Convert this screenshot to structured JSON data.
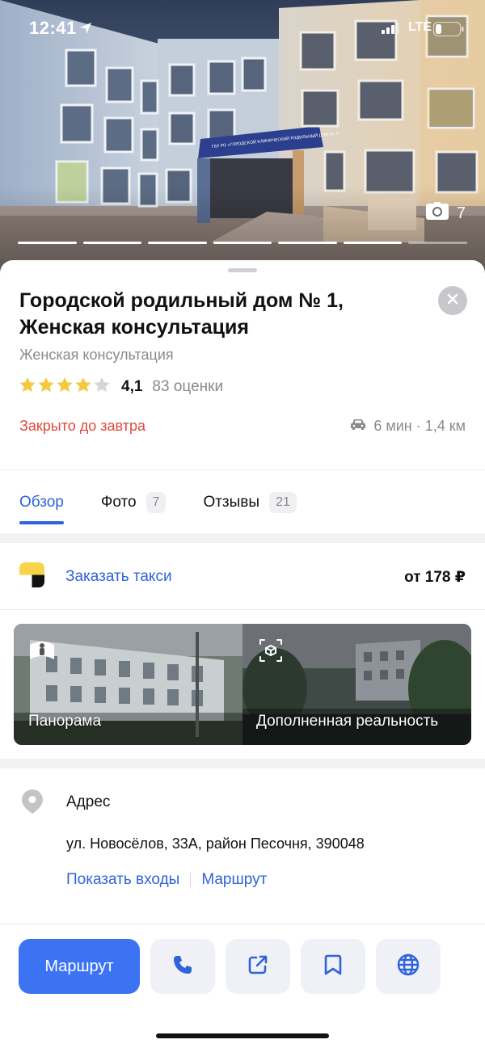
{
  "status_bar": {
    "time": "12:41",
    "network": "LTE"
  },
  "hero": {
    "photo_count": "7",
    "sign_text": "ГБУ РО «ГОРОДСКОЙ КЛИНИЧЕСКИЙ РОДИЛЬНЫЙ ДОМ № 1»",
    "slides_total": 7,
    "slides_active": 6
  },
  "place": {
    "title": "Городской родильный дом № 1, Женская консультация",
    "category": "Женская консультация",
    "rating": "4,1",
    "rating_stars": 4,
    "rating_count": "83 оценки",
    "hours_status": "Закрыто до завтра",
    "drive_info": "6 мин · 1,4 км"
  },
  "tabs": [
    {
      "label": "Обзор",
      "count": ""
    },
    {
      "label": "Фото",
      "count": "7"
    },
    {
      "label": "Отзывы",
      "count": "21"
    }
  ],
  "taxi": {
    "label": "Заказать такси",
    "price": "от 178 ₽"
  },
  "media": {
    "panorama_label": "Панорама",
    "ar_label": "Дополненная реальность"
  },
  "address": {
    "title": "Адрес",
    "text": "ул. Новосёлов, 33А, район Песочня, 390048",
    "show_entrances": "Показать входы",
    "route_link": "Маршрут"
  },
  "action_bar": {
    "route_button": "Маршрут"
  },
  "colors": {
    "accent": "#3b73f2",
    "link": "#2e63d9",
    "closed": "#e0493a",
    "star": "#f5c842"
  }
}
